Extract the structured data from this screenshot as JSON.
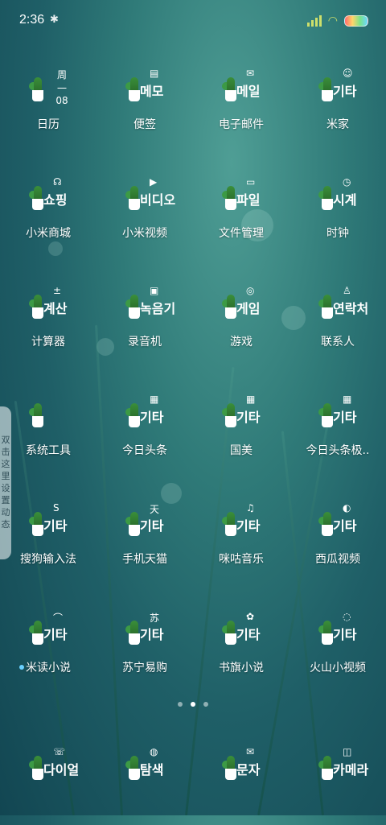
{
  "status": {
    "time": "2:36"
  },
  "apps": [
    {
      "label": "日历",
      "korean": "",
      "glyph": "周一 08"
    },
    {
      "label": "便签",
      "korean": "메모",
      "glyph": "▤"
    },
    {
      "label": "电子邮件",
      "korean": "메일",
      "glyph": "✉"
    },
    {
      "label": "米家",
      "korean": "기타",
      "glyph": "☺"
    },
    {
      "label": "小米商城",
      "korean": "쇼핑",
      "glyph": "☊"
    },
    {
      "label": "小米视频",
      "korean": "비디오",
      "glyph": "▶"
    },
    {
      "label": "文件管理",
      "korean": "파일",
      "glyph": "▭"
    },
    {
      "label": "时钟",
      "korean": "시계",
      "glyph": "◷"
    },
    {
      "label": "计算器",
      "korean": "계산",
      "glyph": "±"
    },
    {
      "label": "录音机",
      "korean": "녹음기",
      "glyph": "▣"
    },
    {
      "label": "游戏",
      "korean": "게임",
      "glyph": "◎"
    },
    {
      "label": "联系人",
      "korean": "연락처",
      "glyph": "♙"
    },
    {
      "label": "系统工具",
      "korean": "",
      "glyph": ""
    },
    {
      "label": "今日头条",
      "korean": "기타",
      "glyph": "▦"
    },
    {
      "label": "国美",
      "korean": "기타",
      "glyph": "▦"
    },
    {
      "label": "今日头条极..",
      "korean": "기타",
      "glyph": "▦"
    },
    {
      "label": "搜狗输入法",
      "korean": "기타",
      "glyph": "S"
    },
    {
      "label": "手机天猫",
      "korean": "기타",
      "glyph": "天"
    },
    {
      "label": "咪咕音乐",
      "korean": "기타",
      "glyph": "♫"
    },
    {
      "label": "西瓜视频",
      "korean": "기타",
      "glyph": "◐"
    },
    {
      "label": "米读小说",
      "korean": "기타",
      "glyph": "⌒"
    },
    {
      "label": "苏宁易购",
      "korean": "기타",
      "glyph": "苏"
    },
    {
      "label": "书旗小说",
      "korean": "기타",
      "glyph": "✿"
    },
    {
      "label": "火山小视频",
      "korean": "기타",
      "glyph": "◌"
    }
  ],
  "dock": [
    {
      "korean": "다이얼",
      "glyph": "☏"
    },
    {
      "korean": "탐색",
      "glyph": "◍"
    },
    {
      "korean": "문자",
      "glyph": "✉"
    },
    {
      "korean": "카메라",
      "glyph": "◫"
    }
  ],
  "side_panel": {
    "text": "双击这里设置动态"
  },
  "pager": {
    "count": 3,
    "active": 1
  }
}
